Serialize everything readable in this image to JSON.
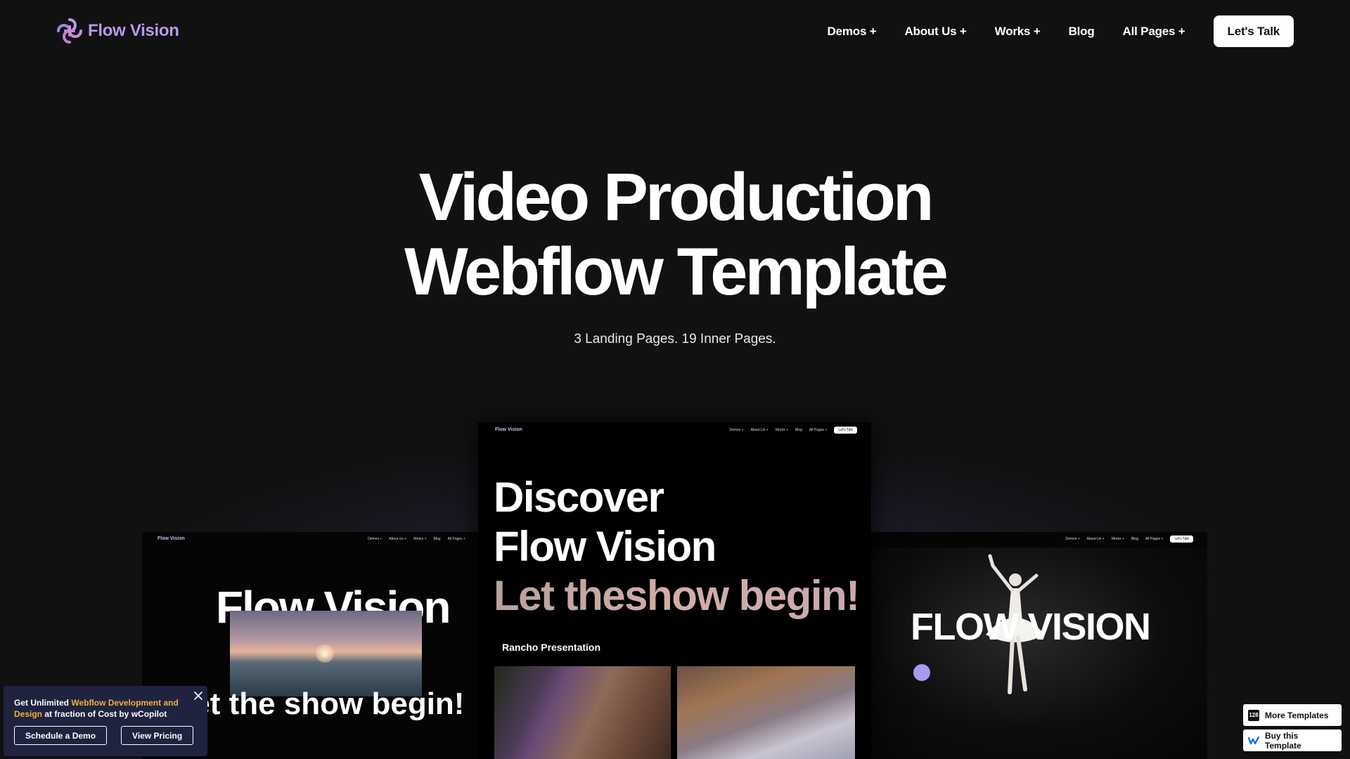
{
  "brand": {
    "name": "Flow Vision",
    "accent": "#b89ae6"
  },
  "nav": {
    "items": [
      {
        "label": "Demos +"
      },
      {
        "label": "About Us +"
      },
      {
        "label": "Works +"
      },
      {
        "label": "Blog"
      },
      {
        "label": "All Pages +"
      }
    ],
    "cta": "Let's Talk"
  },
  "hero": {
    "title_line1": "Video Production",
    "title_line2": "Webflow Template",
    "subtitle": "3 Landing Pages. 19 Inner Pages."
  },
  "previews": {
    "mini_nav": {
      "logo": "Flow Vision",
      "links": [
        "Demos +",
        "About Us +",
        "Works +",
        "Blog",
        "All Pages +"
      ],
      "cta": "Let's Talk"
    },
    "left": {
      "title": "Flow Vision",
      "tag": "let the show begin!"
    },
    "center": {
      "line1": "Discover",
      "line2": "Flow Vision",
      "line3": "Let theshow begin!",
      "subheading": "Rancho Presentation"
    },
    "right": {
      "title": "FLOW VISION"
    }
  },
  "promo": {
    "text_pre": "Get Unlimited ",
    "text_highlight": "Webflow Development and Design",
    "text_post": " at fraction of Cost by wCopilot",
    "btn_demo": "Schedule a Demo",
    "btn_pricing": "View Pricing",
    "highlight_color": "#f0b03a"
  },
  "side": {
    "more_templates": "More Templates",
    "more_count": "128",
    "buy": "Buy this Template"
  }
}
